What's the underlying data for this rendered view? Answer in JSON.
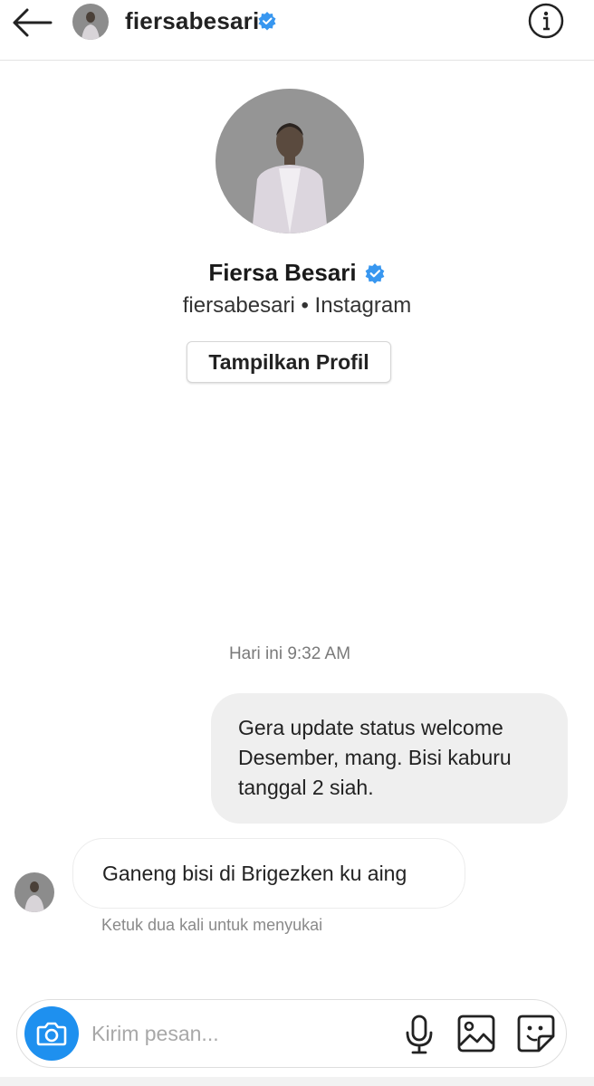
{
  "header": {
    "username": "fiersabesari",
    "icons": {
      "back": "arrow-left-icon",
      "verified": "verified-badge-icon",
      "info": "info-icon"
    }
  },
  "profile": {
    "display_name": "Fiersa Besari",
    "subtitle": "fiersabesari • Instagram",
    "view_profile_label": "Tampilkan Profil"
  },
  "conversation": {
    "timestamp": "Hari ini 9:32 AM",
    "messages": [
      {
        "from": "me",
        "text": "Gera update status welcome Desember, mang. Bisi kaburu tanggal 2 siah."
      },
      {
        "from": "them",
        "text": "Ganeng bisi di Brigezken ku aing"
      }
    ],
    "like_hint": "Ketuk dua kali untuk menyukai"
  },
  "composer": {
    "placeholder": "Kirim pesan...",
    "icons": {
      "camera": "camera-icon",
      "mic": "microphone-icon",
      "gallery": "image-icon",
      "sticker": "sticker-icon"
    }
  },
  "colors": {
    "accent": "#1e90ef",
    "verified": "#3897f0",
    "bubble_sent": "#efefef"
  }
}
